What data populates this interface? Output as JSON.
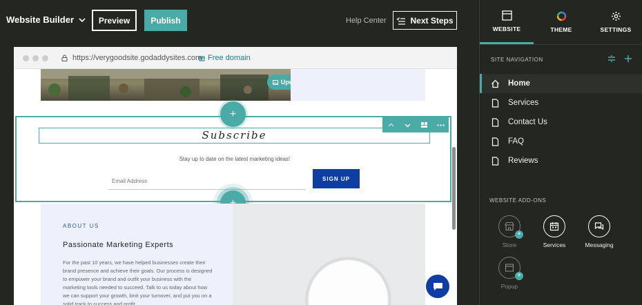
{
  "topbar": {
    "builder_label": "Website Builder",
    "preview_label": "Preview",
    "publish_label": "Publish",
    "help_label": "Help Center",
    "next_steps_label": "Next Steps"
  },
  "browser": {
    "url": "https://verygoodsite.godaddysites.com",
    "free_domain_label": "Free domain"
  },
  "hero": {
    "update_label": "Update"
  },
  "subscribe": {
    "title": "Subscribe",
    "text": "Stay up to date on the latest marketing ideas!",
    "email_placeholder": "Email Address",
    "signup_label": "SIGN UP"
  },
  "about": {
    "eyebrow": "ABOUT US",
    "heading": "Passionate Marketing Experts",
    "body": "For the past 10 years, we have helped businesses create their brand presence and achieve their goals. Our process is designed to empower your brand and outfit your business with the marketing tools needed to succeed. Talk to us today about how we can support your growth, limit your turnover, and put you on a solid track to success and profit."
  },
  "panel": {
    "tabs": [
      {
        "label": "WEBSITE",
        "icon": "layout-icon",
        "active": true
      },
      {
        "label": "THEME",
        "icon": "color-wheel-icon",
        "active": false
      },
      {
        "label": "SETTINGS",
        "icon": "gear-icon",
        "active": false
      }
    ],
    "site_nav_label": "SITE NAVIGATION",
    "nav_items": [
      {
        "label": "Home",
        "icon": "home-icon",
        "active": true
      },
      {
        "label": "Services",
        "icon": "page-icon",
        "active": false
      },
      {
        "label": "Contact Us",
        "icon": "page-icon",
        "active": false
      },
      {
        "label": "FAQ",
        "icon": "page-icon",
        "active": false
      },
      {
        "label": "Reviews",
        "icon": "page-icon",
        "active": false
      }
    ],
    "addons_label": "WEBSITE ADD-ONS",
    "addons": [
      {
        "label": "Store",
        "icon": "store-icon",
        "installed": false
      },
      {
        "label": "Services",
        "icon": "calendar-icon",
        "installed": true
      },
      {
        "label": "Messaging",
        "icon": "messaging-icon",
        "installed": true
      },
      {
        "label": "Popup",
        "icon": "popup-icon",
        "installed": false
      }
    ]
  },
  "colors": {
    "accent": "#4aaaa5",
    "brand_blue": "#0e3ea3",
    "panel_bg": "#242622"
  }
}
